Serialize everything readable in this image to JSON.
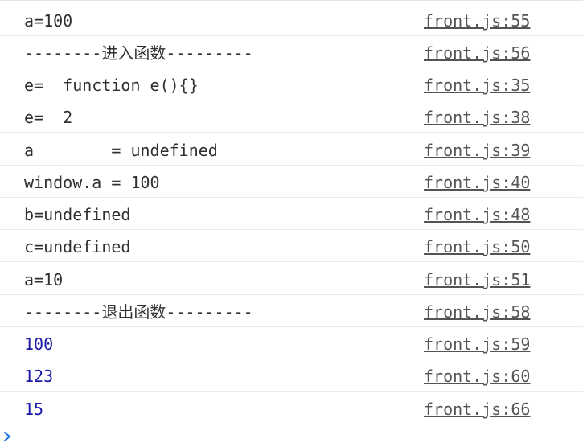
{
  "console": {
    "messages": [
      {
        "text": "a=100",
        "type": "log",
        "source": "front.js:55"
      },
      {
        "text": "--------进入函数---------",
        "type": "log",
        "source": "front.js:56"
      },
      {
        "text": "e=  function e(){}",
        "type": "log",
        "source": "front.js:35"
      },
      {
        "text": "e=  2",
        "type": "log",
        "source": "front.js:38"
      },
      {
        "text": "a        = undefined",
        "type": "log",
        "source": "front.js:39"
      },
      {
        "text": "window.a = 100",
        "type": "log",
        "source": "front.js:40"
      },
      {
        "text": "b=undefined",
        "type": "log",
        "source": "front.js:48"
      },
      {
        "text": "c=undefined",
        "type": "log",
        "source": "front.js:50"
      },
      {
        "text": "a=10",
        "type": "log",
        "source": "front.js:51"
      },
      {
        "text": "--------退出函数---------",
        "type": "log",
        "source": "front.js:58"
      },
      {
        "text": "100",
        "type": "number",
        "source": "front.js:59"
      },
      {
        "text": "123",
        "type": "number",
        "source": "front.js:60"
      },
      {
        "text": "15",
        "type": "number",
        "source": "front.js:66"
      }
    ],
    "prompt_icon": "chevron-right-icon",
    "colors": {
      "text": "#303030",
      "number": "#1a1aa6",
      "link": "#545454",
      "prompt": "#1a73e8",
      "divider": "#ececec"
    }
  }
}
